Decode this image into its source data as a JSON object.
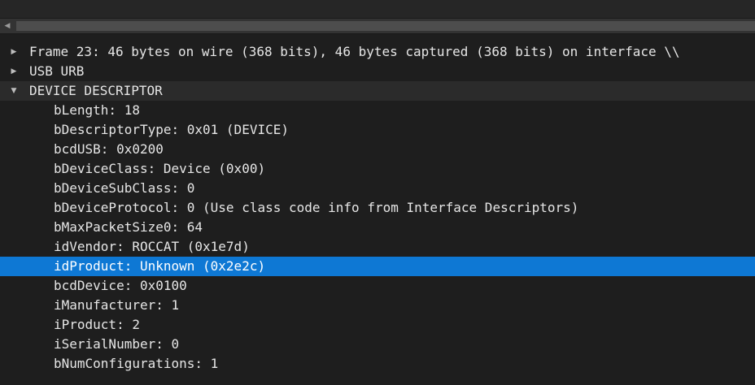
{
  "tree": {
    "rows": [
      {
        "text": "Frame 23: 46 bytes on wire (368 bits), 46 bytes captured (368 bits) on interface \\\\",
        "expander": "collapsed"
      },
      {
        "text": "USB URB",
        "expander": "collapsed"
      },
      {
        "text": "DEVICE DESCRIPTOR",
        "expander": "expanded"
      },
      {
        "text": "bLength: 18"
      },
      {
        "text": "bDescriptorType: 0x01 (DEVICE)"
      },
      {
        "text": "bcdUSB: 0x0200"
      },
      {
        "text": "bDeviceClass: Device (0x00)"
      },
      {
        "text": "bDeviceSubClass: 0"
      },
      {
        "text": "bDeviceProtocol: 0 (Use class code info from Interface Descriptors)"
      },
      {
        "text": "bMaxPacketSize0: 64"
      },
      {
        "text": "idVendor: ROCCAT (0x1e7d)"
      },
      {
        "text": "idProduct: Unknown (0x2e2c)",
        "selected": true
      },
      {
        "text": "bcdDevice: 0x0100"
      },
      {
        "text": "iManufacturer: 1"
      },
      {
        "text": "iProduct: 2"
      },
      {
        "text": "iSerialNumber: 0"
      },
      {
        "text": "bNumConfigurations: 1"
      }
    ]
  },
  "icons": {
    "scroll_left": "scroll-left-arrow-icon",
    "collapsed": "expand-triangle-icon",
    "expanded": "collapse-triangle-icon"
  },
  "colors": {
    "background": "#1e1e1e",
    "selection": "#0e78d4",
    "text": "#e6e6e6"
  }
}
